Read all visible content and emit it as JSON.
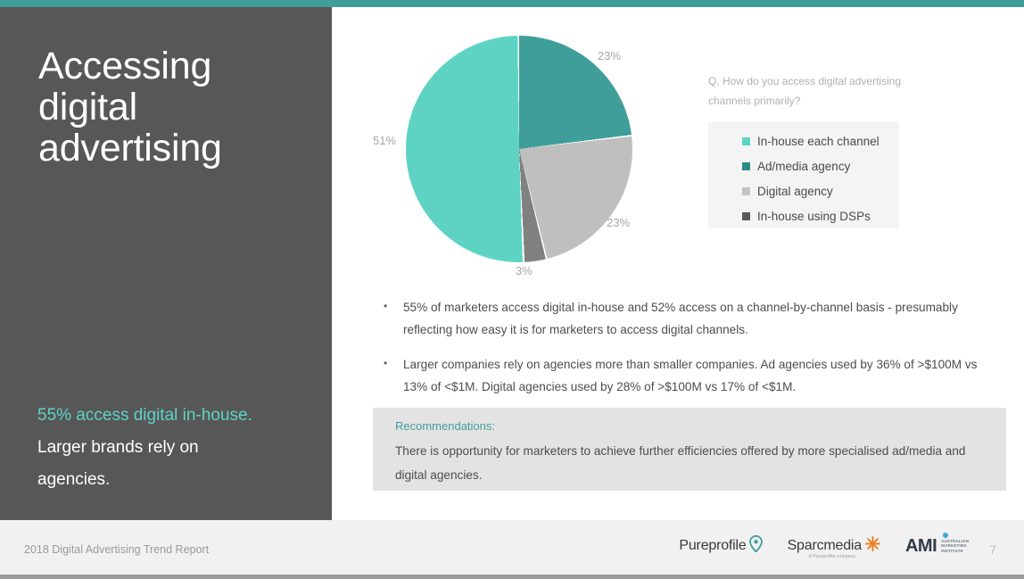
{
  "theme": {
    "accent_teal": "#3f9e9a",
    "light_teal": "#5ed3c4",
    "light_gray": "#bfbfbf",
    "dark_gray": "#808080",
    "panel_gray": "#575757"
  },
  "sidebar": {
    "title": "Accessing digital advertising",
    "kicker_highlight": "55% access digital in-house.",
    "kicker_sub_line1": "Larger brands rely on",
    "kicker_sub_line2": "agencies."
  },
  "question": "Q. How do you access digital advertising channels primarily?",
  "chart_data": {
    "type": "pie",
    "title": "",
    "categories": [
      "In-house each channel",
      "Ad/media agency",
      "Digital agency",
      "In-house using DSPs"
    ],
    "values": [
      51,
      23,
      23,
      3
    ],
    "value_labels": [
      "51%",
      "23%",
      "23%",
      "3%"
    ],
    "colors": [
      "#5ed3c4",
      "#3f9e9a",
      "#bfbfbf",
      "#808080"
    ],
    "legend": [
      {
        "label": "In-house each channel",
        "color": "#5ed3c4"
      },
      {
        "label": "Ad/media agency",
        "color": "#3f9e9a"
      },
      {
        "label": "Digital agency",
        "color": "#bfbfbf"
      },
      {
        "label": "In-house using DSPs",
        "color": "#595959"
      }
    ],
    "legend_position": "right",
    "grid": false
  },
  "bullets": [
    {
      "marker": "•",
      "text": "55% of marketers access digital in-house and 52% access on a channel-by-channel basis - presumably reflecting how easy it is for marketers to access digital channels."
    },
    {
      "marker": "•",
      "text": "Larger companies rely on agencies more than smaller companies. Ad agencies used by 36% of >$100M vs 13% of <$1M. Digital agencies used by 28% of >$100M vs 17% of <$1M."
    }
  ],
  "recommendations": {
    "title": "Recommendations:",
    "body": "There is opportunity for marketers to achieve further efficiencies offered by more specialised ad/media and digital agencies."
  },
  "footer": {
    "report_name": "2018 Digital Advertising Trend Report",
    "page_number": "7",
    "logos": {
      "pureprofile": "Pureprofile",
      "sparcmedia": "Sparcmedia",
      "sparcmedia_tagline": "A Pureprofile company",
      "ami": "AMI",
      "ami_line1": "AUSTRALIAN",
      "ami_line2": "MARKETING",
      "ami_line3": "INSTITUTE"
    }
  }
}
